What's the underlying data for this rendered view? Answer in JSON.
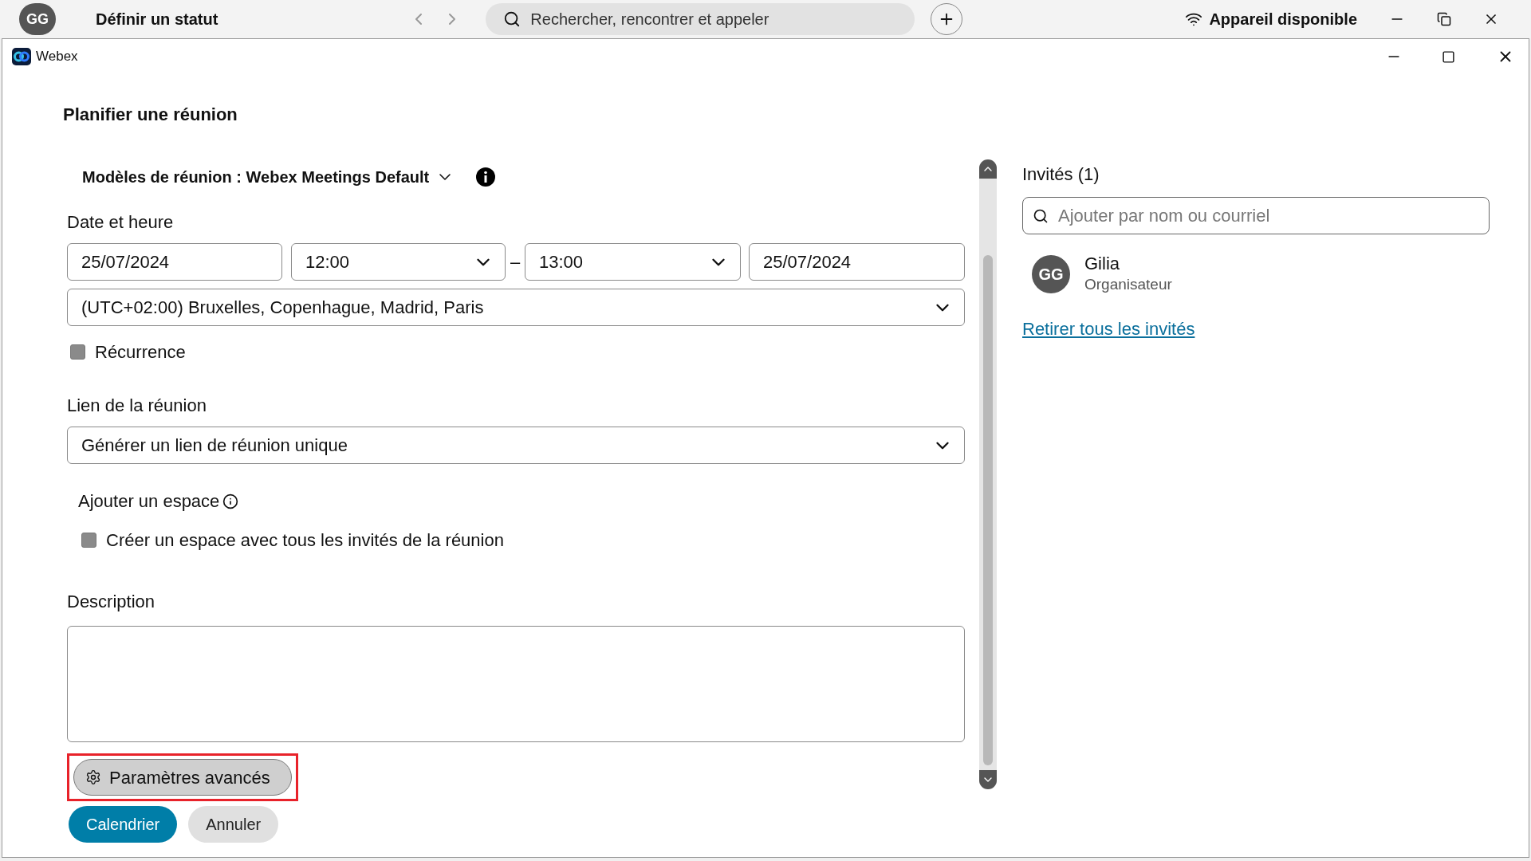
{
  "background_app": {
    "avatar_initials": "GG",
    "status": "Définir un statut",
    "search_placeholder": "Rechercher, rencontrer et appeler",
    "device": "Appareil disponible"
  },
  "window": {
    "title": "Webex"
  },
  "dialog": {
    "title": "Planifier une réunion",
    "template": "Modèles de réunion : Webex Meetings Default",
    "date_label": "Date et heure",
    "start_date": "25/07/2024",
    "start_time": "12:00",
    "separator": "–",
    "end_time": "13:00",
    "end_date": "25/07/2024",
    "timezone": "(UTC+02:00) Bruxelles, Copenhague, Madrid, Paris",
    "recurrence": {
      "label": "Récurrence",
      "checked": false
    },
    "link_label": "Lien de la réunion",
    "link_option": "Générer un lien de réunion unique",
    "space_label": "Ajouter un espace",
    "space_checkbox": {
      "label": "Créer un espace avec tous les invités de la réunion",
      "checked": false
    },
    "description_label": "Description",
    "advanced_button": {
      "label": "Paramètres avancés",
      "highlighted": true
    },
    "buttons": [
      {
        "label": "Calendrier",
        "kind": "primary"
      },
      {
        "label": "Annuler",
        "kind": "secondary"
      }
    ]
  },
  "invitees": {
    "title": "Invités (1)",
    "search_placeholder": "Ajouter par nom ou courriel",
    "people": [
      {
        "initials": "GG",
        "name": "Gilia",
        "role": "Organisateur"
      }
    ],
    "remove_all": "Retirer tous les invités"
  }
}
